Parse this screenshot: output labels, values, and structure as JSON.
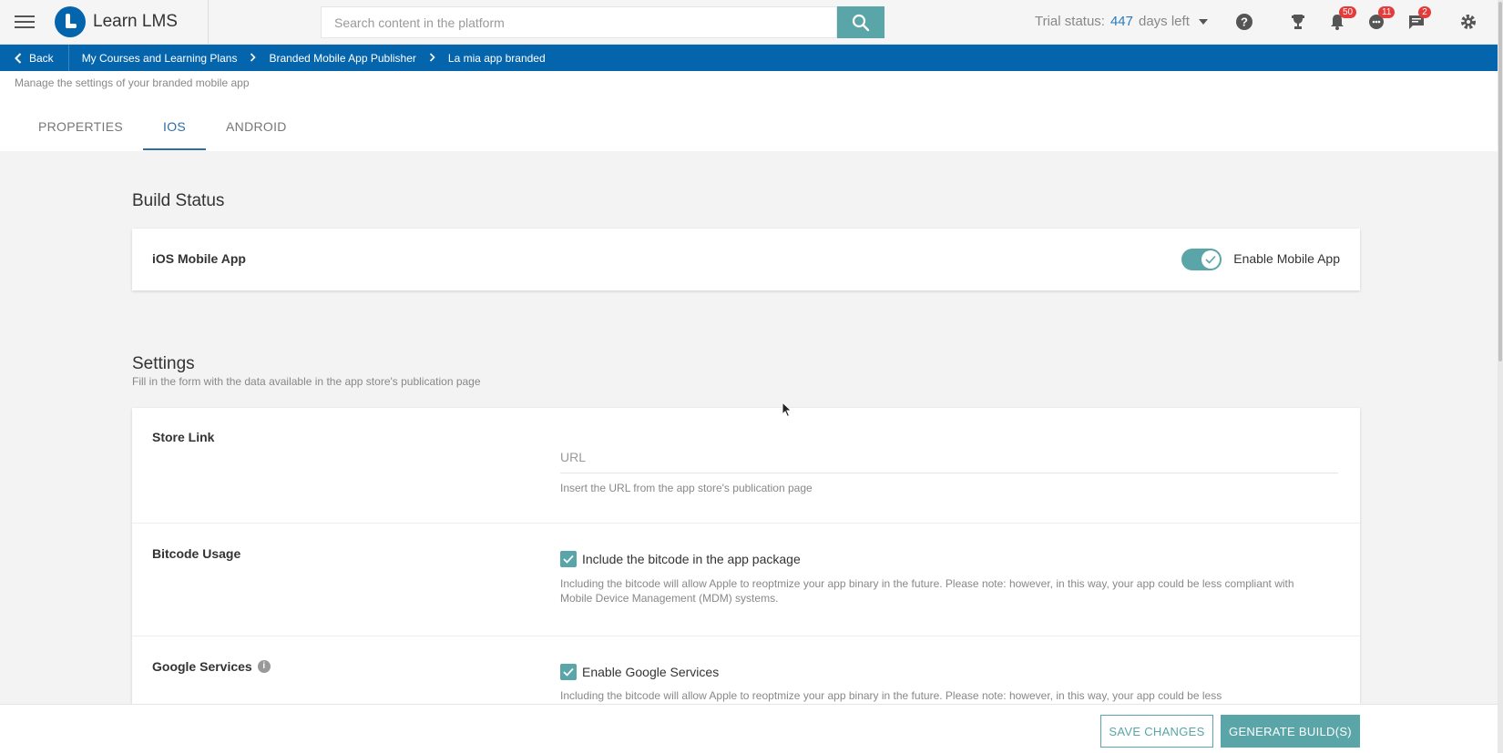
{
  "topbar": {
    "brand": "Learn LMS",
    "search_placeholder": "Search content in the platform",
    "trial_prefix": "Trial status:",
    "trial_days": "447",
    "trial_suffix": "days left",
    "badges": {
      "notifications": "50",
      "chat": "11",
      "messages": "2"
    },
    "icons": [
      "menu-icon",
      "search-icon",
      "help-icon",
      "trophy-icon",
      "bell-icon",
      "chat-icon",
      "messages-icon",
      "gear-icon"
    ]
  },
  "breadcrumb": {
    "back": "Back",
    "items": [
      "My Courses and Learning Plans",
      "Branded Mobile App Publisher",
      "La mia app branded"
    ]
  },
  "header": {
    "subtitle": "Manage the settings of your branded mobile app",
    "tabs": [
      {
        "label": "PROPERTIES",
        "active": false
      },
      {
        "label": "IOS",
        "active": true
      },
      {
        "label": "ANDROID",
        "active": false
      }
    ]
  },
  "build_status": {
    "title": "Build Status",
    "row_label": "iOS Mobile App",
    "toggle_label": "Enable Mobile App",
    "enabled": true
  },
  "settings": {
    "title": "Settings",
    "description": "Fill in the form with the data available in the app store's publication page",
    "store_link": {
      "label": "Store Link",
      "placeholder": "URL",
      "help": "Insert the URL from the app store's publication page"
    },
    "bitcode": {
      "label": "Bitcode Usage",
      "checkbox_label": "Include the bitcode in the app package",
      "checked": true,
      "help": "Including the bitcode will allow Apple to reoptmize your app binary in the future. Please note: however, in this way, your app could be less compliant with Mobile Device Management (MDM) systems."
    },
    "google_services": {
      "label": "Google Services",
      "checkbox_label": "Enable Google Services",
      "checked": true,
      "help": "Including the bitcode will allow Apple to reoptmize your app binary in the future. Please note: however, in this way, your app could be less"
    }
  },
  "footer": {
    "save": "SAVE CHANGES",
    "generate": "GENERATE BUILD(S)"
  },
  "colors": {
    "primary_blue": "#0465ac",
    "teal": "#5aa5a8",
    "badge_red": "#e43b3b"
  }
}
